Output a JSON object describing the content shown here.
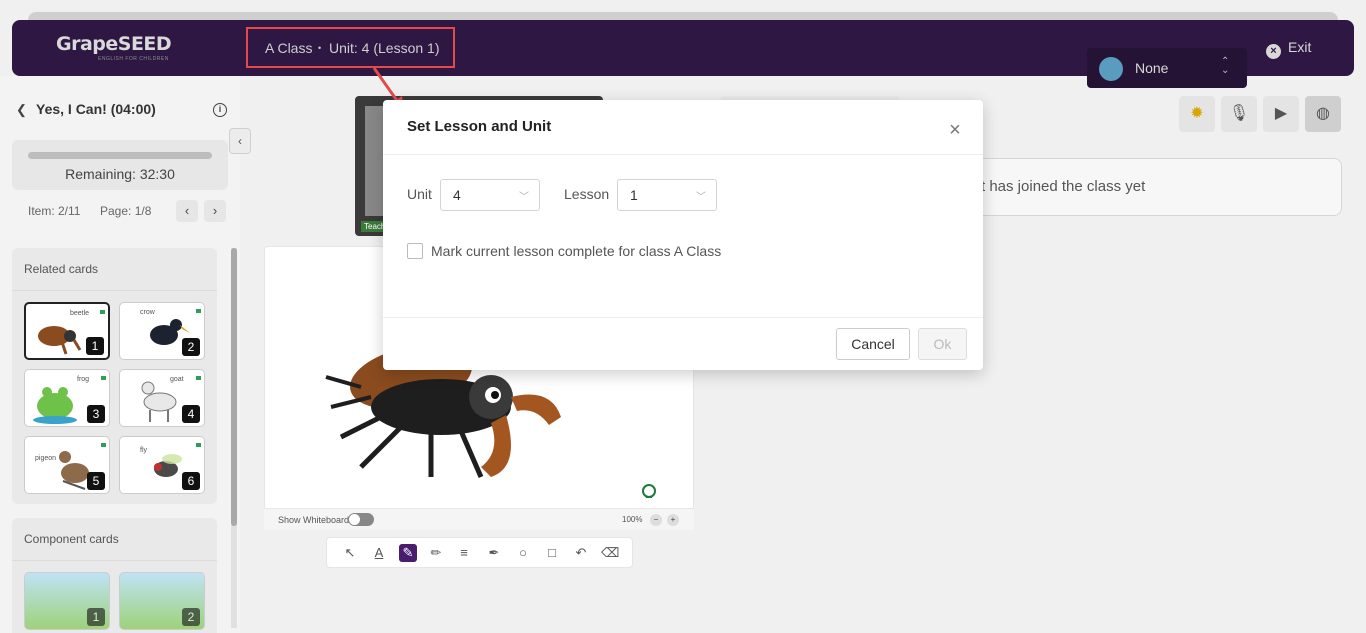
{
  "header": {
    "logo": "GrapeSEED",
    "logo_tagline": "ENGLISH FOR CHILDREN",
    "class_name": "A Class",
    "separator": "•",
    "unit_text": "Unit: 4 (Lesson 1)",
    "user_name": "None",
    "exit_label": "Exit"
  },
  "sidebar": {
    "title": "Yes, I Can! (04:00)",
    "remaining": "Remaining: 32:30",
    "item": "Item: 2/11",
    "page": "Page: 1/8",
    "related_title": "Related cards",
    "related_cards": [
      {
        "word": "beetle",
        "num": "1"
      },
      {
        "word": "crow",
        "num": "2"
      },
      {
        "word": "frog",
        "num": "3"
      },
      {
        "word": "goat",
        "num": "4"
      },
      {
        "word": "pigeon",
        "num": "5"
      },
      {
        "word": "fly",
        "num": "6"
      }
    ],
    "component_title": "Component cards",
    "component_cards": [
      {
        "num": "1"
      },
      {
        "num": "2"
      }
    ]
  },
  "main": {
    "video_label": "Teach",
    "whiteboard_label": "Show Whiteboard",
    "zoom": "100%",
    "message": "t has joined the class yet"
  },
  "modal": {
    "title": "Set Lesson and Unit",
    "unit_label": "Unit",
    "unit_value": "4",
    "lesson_label": "Lesson",
    "lesson_value": "1",
    "checkbox_label": "Mark current lesson complete for class A Class",
    "cancel": "Cancel",
    "ok": "Ok"
  },
  "colors": {
    "header_bg": "#2e1743",
    "highlight": "#e34b4b",
    "accent": "#4a1c6e"
  }
}
